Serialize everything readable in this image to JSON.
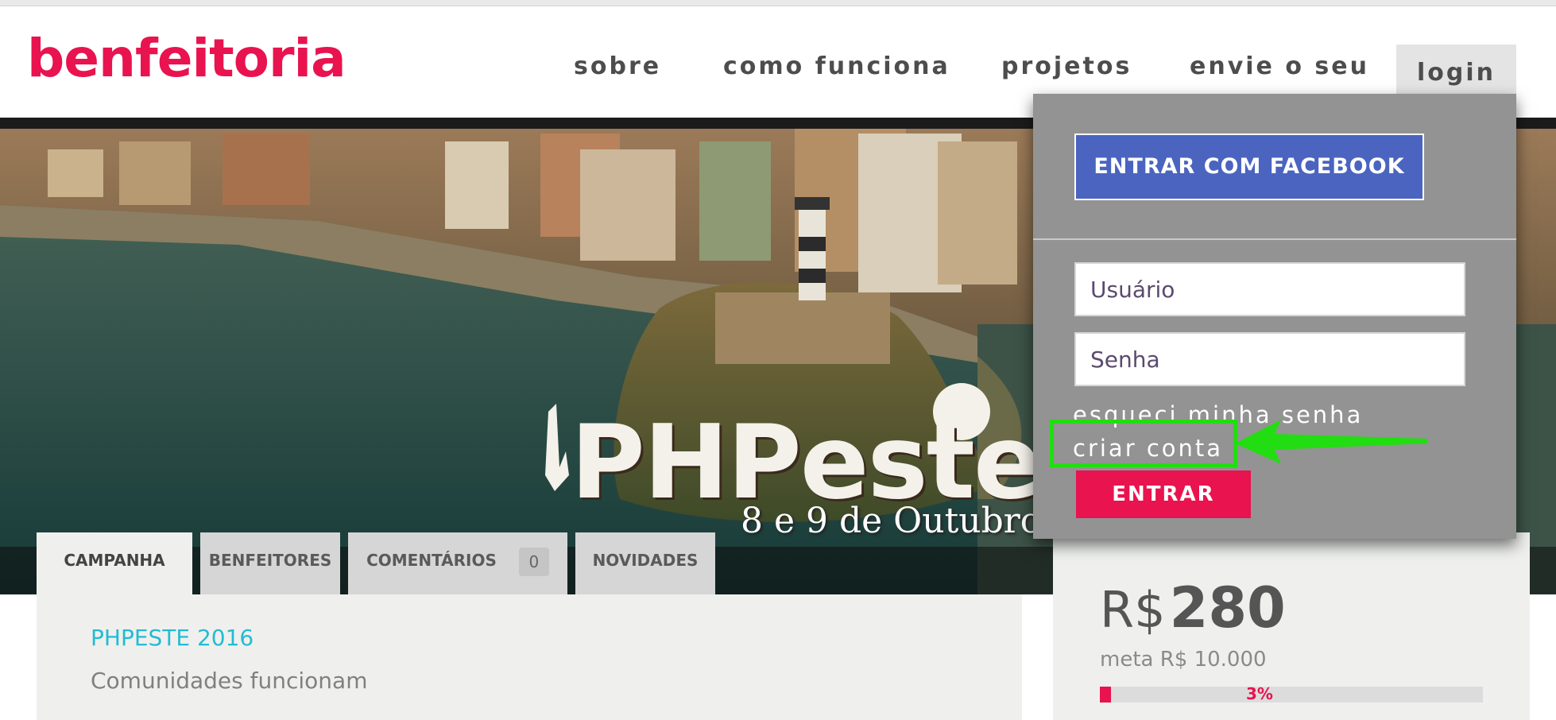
{
  "header": {
    "logo": "benfeitoria",
    "nav": [
      {
        "label": "sobre"
      },
      {
        "label": "como funciona"
      },
      {
        "label": "projetos"
      },
      {
        "label": "envie o seu"
      }
    ],
    "login_label": "login"
  },
  "hero": {
    "title": "PHPeste",
    "date": "8 e 9 de Outubro"
  },
  "tabs": [
    {
      "label": "CAMPANHA",
      "active": true
    },
    {
      "label": "BENFEITORES"
    },
    {
      "label": "COMENTÁRIOS",
      "count": "0"
    },
    {
      "label": "NOVIDADES"
    }
  ],
  "project": {
    "name": "PHPESTE 2016",
    "description": "Comunidades funcionam"
  },
  "funding": {
    "currency": "R$",
    "amount": "280",
    "goal": "meta R$ 10.000",
    "progress_label": "3%",
    "progress_fraction": 0.03
  },
  "login_panel": {
    "facebook_button": "ENTRAR COM FACEBOOK",
    "username_placeholder": "Usuário",
    "password_placeholder": "Senha",
    "forgot_password": "esqueci minha senha",
    "create_account": "criar conta",
    "submit": "ENTRAR"
  },
  "colors": {
    "brand": "#e8134f",
    "facebook": "#4a64c0",
    "panel": "#939393",
    "accent_text": "#22bcd2",
    "annotation": "#22dd11"
  }
}
